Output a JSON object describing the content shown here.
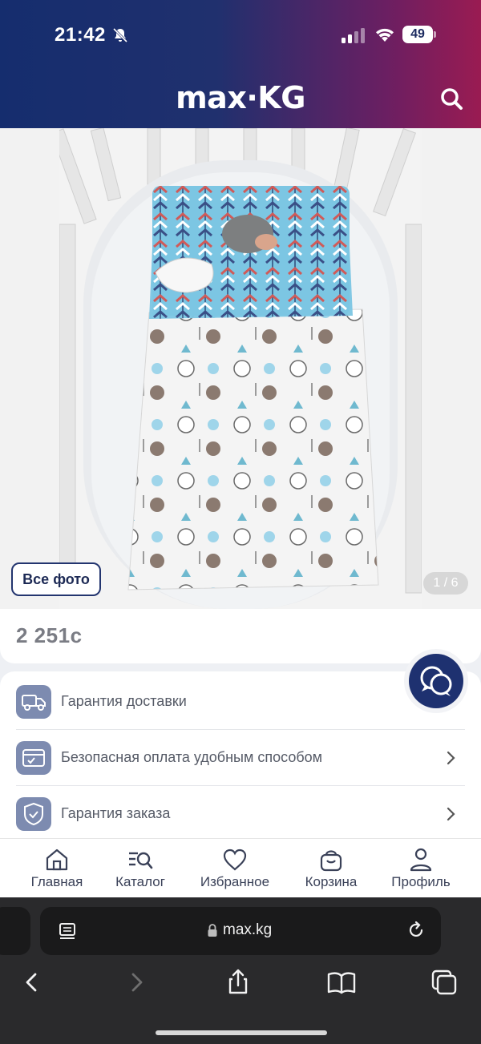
{
  "status_bar": {
    "time": "21:42",
    "battery": "49"
  },
  "brand": {
    "logo_text": "max·KG"
  },
  "gallery": {
    "all_photos_label": "Все фото",
    "counter": "1 / 6"
  },
  "product": {
    "price": "2 251с"
  },
  "info_rows": [
    {
      "label": "Гарантия доставки",
      "icon": "truck-icon"
    },
    {
      "label": "Безопасная оплата удобным способом",
      "icon": "card-check-icon"
    },
    {
      "label": "Гарантия заказа",
      "icon": "shield-check-icon"
    }
  ],
  "bottom_nav": [
    {
      "label": "Главная",
      "icon": "home-icon"
    },
    {
      "label": "Каталог",
      "icon": "catalog-search-icon"
    },
    {
      "label": "Избранное",
      "icon": "heart-icon"
    },
    {
      "label": "Корзина",
      "icon": "bag-icon"
    },
    {
      "label": "Профиль",
      "icon": "profile-icon"
    }
  ],
  "browser": {
    "url": "max.kg"
  },
  "colors": {
    "header_start": "#152d6e",
    "header_end": "#9a1b52",
    "accent": "#1e3170",
    "icon_bg": "#7d8bb0"
  }
}
